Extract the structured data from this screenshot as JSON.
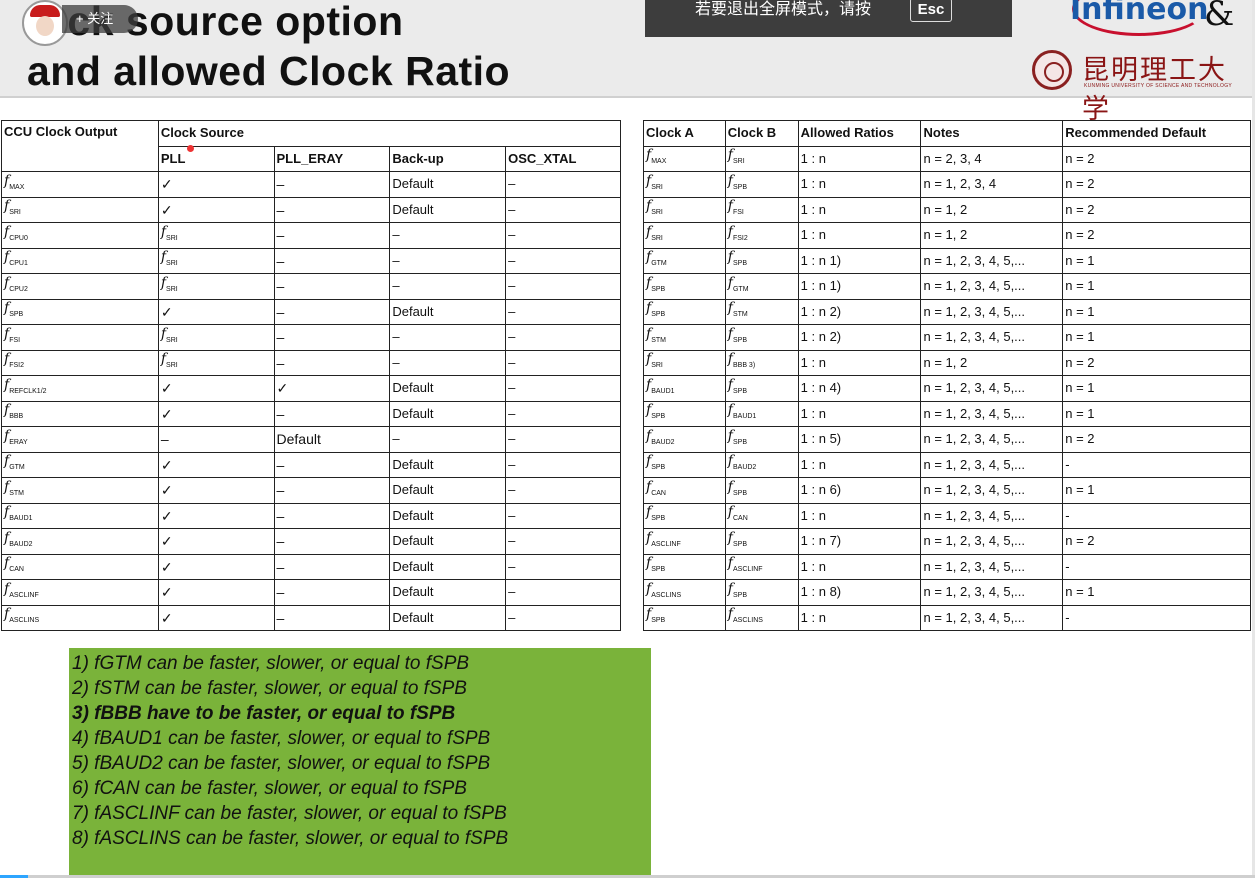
{
  "slide": {
    "title_line1": "lock source option",
    "title_line2": "and allowed Clock Ratio",
    "logo_company": "Infineon",
    "logo_amp": "&",
    "logo_university": "昆明理工大学",
    "logo_university_en": "KUNMING UNIVERSITY OF SCIENCE AND TECHNOLOGY"
  },
  "overlay": {
    "follow_label": "+ 关注",
    "fullscreen_msg": "若要退出全屏模式，请按",
    "esc_key": "Esc"
  },
  "table_left": {
    "header_output": "CCU Clock Output",
    "header_source": "Clock Source",
    "sub_headers": [
      "PLL",
      "PLL_ERAY",
      "Back-up",
      "OSC_XTAL"
    ],
    "rows": [
      {
        "sub": "MAX",
        "pll": "✓",
        "eray": "–",
        "backup": "Default",
        "osc": "–"
      },
      {
        "sub": "SRI",
        "pll": "✓",
        "eray": "–",
        "backup": "Default",
        "osc": "–"
      },
      {
        "sub": "CPU0",
        "pll": "SRI",
        "eray": "–",
        "backup": "–",
        "osc": "–"
      },
      {
        "sub": "CPU1",
        "pll": "SRI",
        "eray": "–",
        "backup": "–",
        "osc": "–"
      },
      {
        "sub": "CPU2",
        "pll": "SRI",
        "eray": "–",
        "backup": "–",
        "osc": "–"
      },
      {
        "sub": "SPB",
        "pll": "✓",
        "eray": "–",
        "backup": "Default",
        "osc": "–"
      },
      {
        "sub": "FSI",
        "pll": "SRI",
        "eray": "–",
        "backup": "–",
        "osc": "–"
      },
      {
        "sub": "FSI2",
        "pll": "SRI",
        "eray": "–",
        "backup": "–",
        "osc": "–"
      },
      {
        "sub": "REFCLK1/2",
        "pll": "✓",
        "eray": "✓",
        "backup": "Default",
        "osc": "–"
      },
      {
        "sub": "BBB",
        "pll": "✓",
        "eray": "–",
        "backup": "Default",
        "osc": "–"
      },
      {
        "sub": "ERAY",
        "pll": "–",
        "eray": "Default",
        "backup": "–",
        "osc": "–"
      },
      {
        "sub": "GTM",
        "pll": "✓",
        "eray": "–",
        "backup": "Default",
        "osc": "–"
      },
      {
        "sub": "STM",
        "pll": "✓",
        "eray": "–",
        "backup": "Default",
        "osc": "–"
      },
      {
        "sub": "BAUD1",
        "pll": "✓",
        "eray": "–",
        "backup": "Default",
        "osc": "–"
      },
      {
        "sub": "BAUD2",
        "pll": "✓",
        "eray": "–",
        "backup": "Default",
        "osc": "–"
      },
      {
        "sub": "CAN",
        "pll": "✓",
        "eray": "–",
        "backup": "Default",
        "osc": "–"
      },
      {
        "sub": "ASCLINF",
        "pll": "✓",
        "eray": "–",
        "backup": "Default",
        "osc": "–"
      },
      {
        "sub": "ASCLINS",
        "pll": "✓",
        "eray": "–",
        "backup": "Default",
        "osc": "–"
      }
    ]
  },
  "table_right": {
    "headers": [
      "Clock A",
      "Clock B",
      "Allowed Ratios",
      "Notes",
      "Recommended Default"
    ],
    "rows": [
      {
        "a": "MAX",
        "b": "SRI",
        "ratio": "1 : n",
        "note": "n = 2, 3, 4",
        "def": "n = 2"
      },
      {
        "a": "SRI",
        "b": "SPB",
        "ratio": "1 : n",
        "note": "n = 1, 2, 3, 4",
        "def": "n = 2"
      },
      {
        "a": "SRI",
        "b": "FSI",
        "ratio": "1 : n",
        "note": "n = 1, 2",
        "def": "n = 2"
      },
      {
        "a": "SRI",
        "b": "FSI2",
        "ratio": "1 : n",
        "note": "n = 1, 2",
        "def": "n = 2"
      },
      {
        "a": "GTM",
        "b": "SPB",
        "ratio": "1 : n 1)",
        "note": "n = 1, 2, 3, 4, 5,...",
        "def": "n = 1"
      },
      {
        "a": "SPB",
        "b": "GTM",
        "ratio": "1 : n 1)",
        "note": "n = 1, 2, 3, 4, 5,...",
        "def": "n = 1"
      },
      {
        "a": "SPB",
        "b": "STM",
        "ratio": "1 : n 2)",
        "note": "n = 1, 2, 3, 4, 5,...",
        "def": "n = 1"
      },
      {
        "a": "STM",
        "b": "SPB",
        "ratio": "1 : n 2)",
        "note": "n = 1, 2, 3, 4, 5,...",
        "def": "n = 1"
      },
      {
        "a": "SRI",
        "b": "BBB 3)",
        "ratio": "1 : n",
        "note": "n = 1, 2",
        "def": "n = 2"
      },
      {
        "a": "BAUD1",
        "b": "SPB",
        "ratio": "1 : n 4)",
        "note": "n = 1, 2, 3, 4, 5,...",
        "def": "n = 1"
      },
      {
        "a": "SPB",
        "b": "BAUD1",
        "ratio": "1 : n",
        "note": "n = 1, 2, 3, 4, 5,...",
        "def": "n = 1"
      },
      {
        "a": "BAUD2",
        "b": "SPB",
        "ratio": "1 : n 5)",
        "note": "n = 1, 2, 3, 4, 5,...",
        "def": "n = 2"
      },
      {
        "a": "SPB",
        "b": "BAUD2",
        "ratio": "1 : n",
        "note": "n = 1, 2, 3, 4, 5,...",
        "def": "-"
      },
      {
        "a": "CAN",
        "b": "SPB",
        "ratio": "1 : n 6)",
        "note": "n = 1, 2, 3, 4, 5,...",
        "def": "n = 1"
      },
      {
        "a": "SPB",
        "b": "CAN",
        "ratio": "1 : n",
        "note": "n = 1, 2, 3, 4, 5,...",
        "def": "-"
      },
      {
        "a": "ASCLINF",
        "b": "SPB",
        "ratio": "1 : n 7)",
        "note": "n = 1, 2, 3, 4, 5,...",
        "def": "n = 2"
      },
      {
        "a": "SPB",
        "b": "ASCLINF",
        "ratio": "1 : n",
        "note": "n = 1, 2, 3, 4, 5,...",
        "def": "-"
      },
      {
        "a": "ASCLINS",
        "b": "SPB",
        "ratio": "1 : n 8)",
        "note": "n = 1, 2, 3, 4, 5,...",
        "def": "n = 1"
      },
      {
        "a": "SPB",
        "b": "ASCLINS",
        "ratio": "1 : n",
        "note": "n = 1, 2, 3, 4, 5,...",
        "def": "-"
      }
    ]
  },
  "notes": [
    {
      "text": "1) fGTM can be faster, slower, or equal to fSPB",
      "bold": false
    },
    {
      "text": "2) fSTM can be faster, slower, or equal to fSPB",
      "bold": false
    },
    {
      "text": "3) fBBB have to be faster, or equal to fSPB",
      "bold": true
    },
    {
      "text": "4) fBAUD1 can be faster, slower, or equal to fSPB",
      "bold": false
    },
    {
      "text": "5) fBAUD2 can be faster, slower, or equal to fSPB",
      "bold": false
    },
    {
      "text": "6) fCAN can be faster, slower, or equal to fSPB",
      "bold": false
    },
    {
      "text": "7) fASCLINF can be faster, slower, or equal to fSPB",
      "bold": false
    },
    {
      "text": "8) fASCLINS can be faster, slower, or equal to fSPB",
      "bold": false
    }
  ]
}
